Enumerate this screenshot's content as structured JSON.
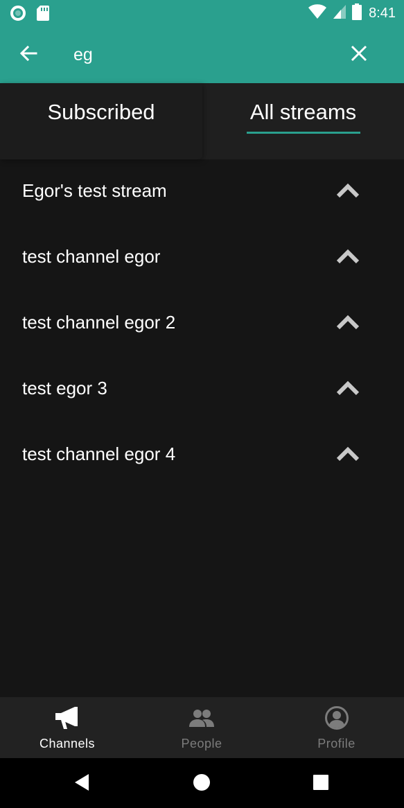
{
  "status_bar": {
    "time": "8:41",
    "icons": [
      "circle-notification-icon",
      "sd-card-icon",
      "wifi-icon",
      "cell-signal-icon",
      "battery-icon"
    ]
  },
  "search": {
    "value": "eg",
    "back_icon": "arrow-back-icon",
    "clear_icon": "close-icon"
  },
  "tabs": [
    {
      "label": "Subscribed",
      "active": false
    },
    {
      "label": "All streams",
      "active": true
    }
  ],
  "streams": [
    {
      "name": "Egor's test stream"
    },
    {
      "name": "test channel egor"
    },
    {
      "name": "test channel egor 2"
    },
    {
      "name": "test egor 3"
    },
    {
      "name": "test channel egor 4"
    }
  ],
  "bottom_nav": [
    {
      "label": "Channels",
      "icon": "megaphone-icon",
      "active": true
    },
    {
      "label": "People",
      "icon": "people-icon",
      "active": false
    },
    {
      "label": "Profile",
      "icon": "account-circle-icon",
      "active": false
    }
  ],
  "colors": {
    "accent": "#2aa08e",
    "background": "#151515",
    "tab_bar": "#1f1f1f",
    "bottom_nav": "#222222",
    "text": "#ffffff",
    "inactive": "#7c7c7c"
  }
}
